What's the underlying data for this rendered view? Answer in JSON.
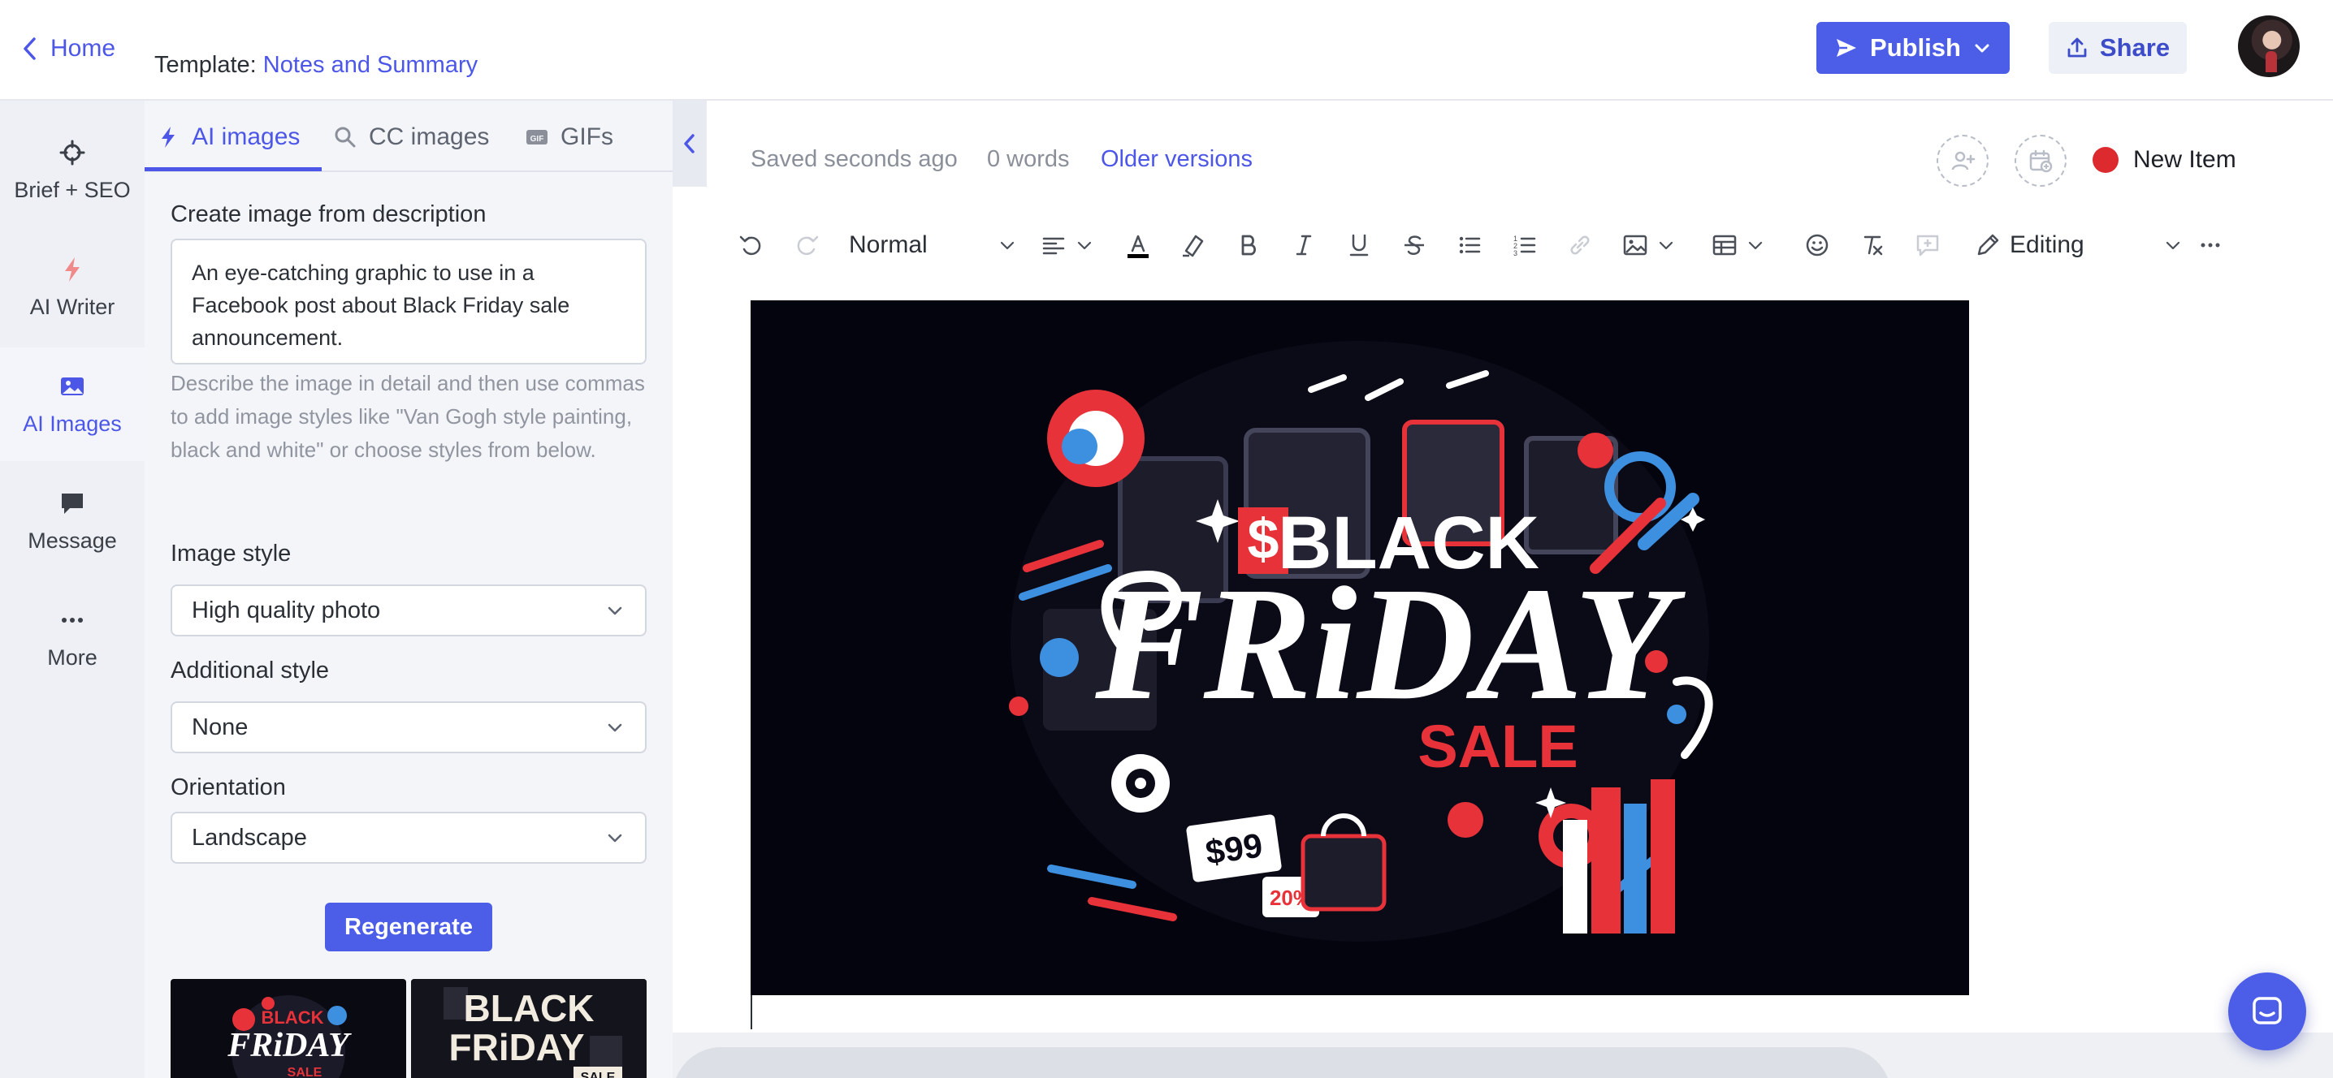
{
  "header": {
    "home_label": "Home",
    "template_prefix": "Template:",
    "template_name": "Notes and Summary",
    "publish_label": "Publish",
    "share_label": "Share"
  },
  "leftnav": {
    "items": [
      {
        "label": "Brief + SEO",
        "icon": "crosshair-icon"
      },
      {
        "label": "AI Writer",
        "icon": "bolt-icon"
      },
      {
        "label": "AI Images",
        "icon": "image-icon",
        "active": true
      },
      {
        "label": "Message",
        "icon": "chat-bubble-icon"
      },
      {
        "label": "More",
        "icon": "more-dots-icon"
      }
    ]
  },
  "panel": {
    "tabs": [
      {
        "label": "AI images",
        "active": true
      },
      {
        "label": "CC images"
      },
      {
        "label": "GIFs"
      }
    ],
    "create_label": "Create image from description",
    "description_value": "An eye-catching graphic to use in a Facebook post about Black Friday sale announcement.",
    "help_text": "Describe the image in detail and then use commas to add image styles like \"Van Gogh style painting, black and white\" or choose styles from below.",
    "image_style_label": "Image style",
    "image_style_value": "High quality photo",
    "additional_style_label": "Additional style",
    "additional_style_value": "None",
    "orientation_label": "Orientation",
    "orientation_value": "Landscape",
    "regenerate_label": "Regenerate"
  },
  "editor": {
    "saved_status": "Saved seconds ago",
    "word_count": "0 words",
    "older_versions": "Older versions",
    "new_item_label": "New Item",
    "status_color": "#dc2a2f",
    "toolbar": {
      "block_style": "Normal",
      "mode": "Editing"
    },
    "image_text": {
      "line1": "BLACK",
      "line2": "FRiDAY",
      "line3": "SALE",
      "price_tag": "$99",
      "percent_tag": "20%"
    }
  },
  "colors": {
    "accent": "#4c5ee8",
    "link": "#4c57e8",
    "sale_red": "#e8323a",
    "sale_blue": "#3d8fe0"
  }
}
